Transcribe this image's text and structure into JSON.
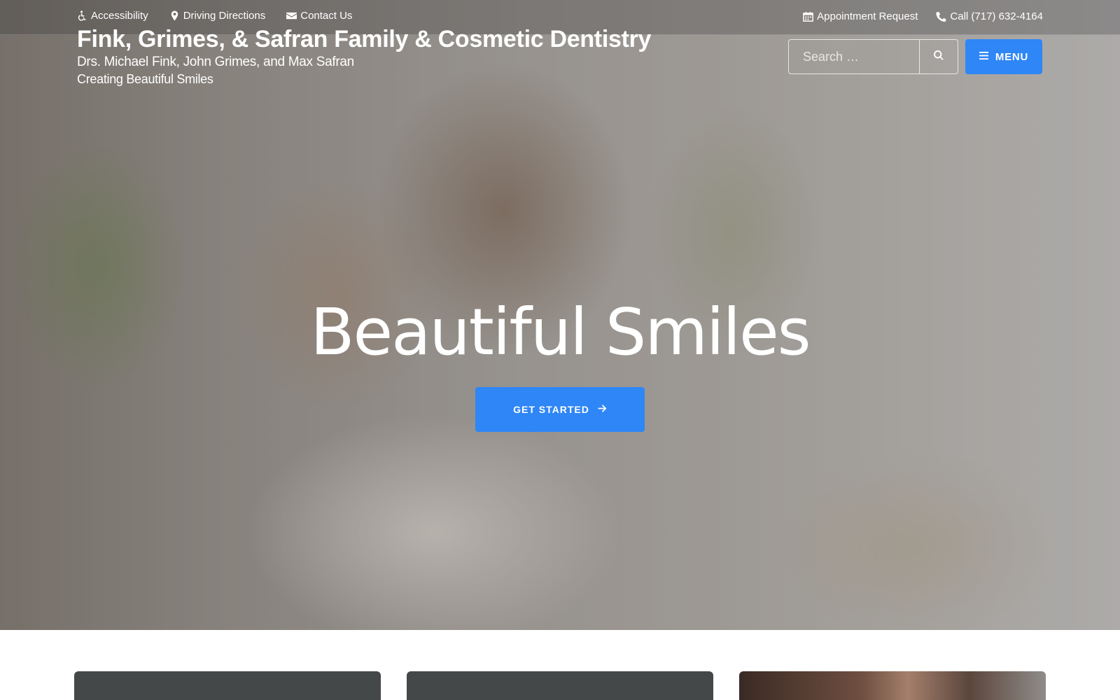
{
  "topbar": {
    "left_links": [
      {
        "label": "Accessibility",
        "icon": "wheelchair-icon"
      },
      {
        "label": "Driving Directions",
        "icon": "map-marker-icon"
      },
      {
        "label": "Contact Us",
        "icon": "envelope-icon"
      }
    ],
    "right_links": [
      {
        "label": "Appointment Request",
        "icon": "calendar-icon"
      },
      {
        "label": "Call (717) 632-4164",
        "icon": "phone-icon"
      }
    ]
  },
  "brand": {
    "title": "Fink, Grimes, & Safran Family & Cosmetic Dentistry",
    "subtitle": "Drs. Michael Fink, John Grimes, and Max Safran",
    "tagline": "Creating Beautiful Smiles"
  },
  "search": {
    "placeholder": "Search …",
    "value": "",
    "button_icon": "search-icon"
  },
  "menu": {
    "label": "MENU",
    "icon": "hamburger-icon"
  },
  "hero": {
    "headline": "Beautiful Smiles",
    "cta_label": "GET STARTED",
    "cta_icon": "arrow-right-icon"
  },
  "colors": {
    "accent": "#2f86f6",
    "card_dark": "#444849",
    "text_light": "#ffffff"
  }
}
